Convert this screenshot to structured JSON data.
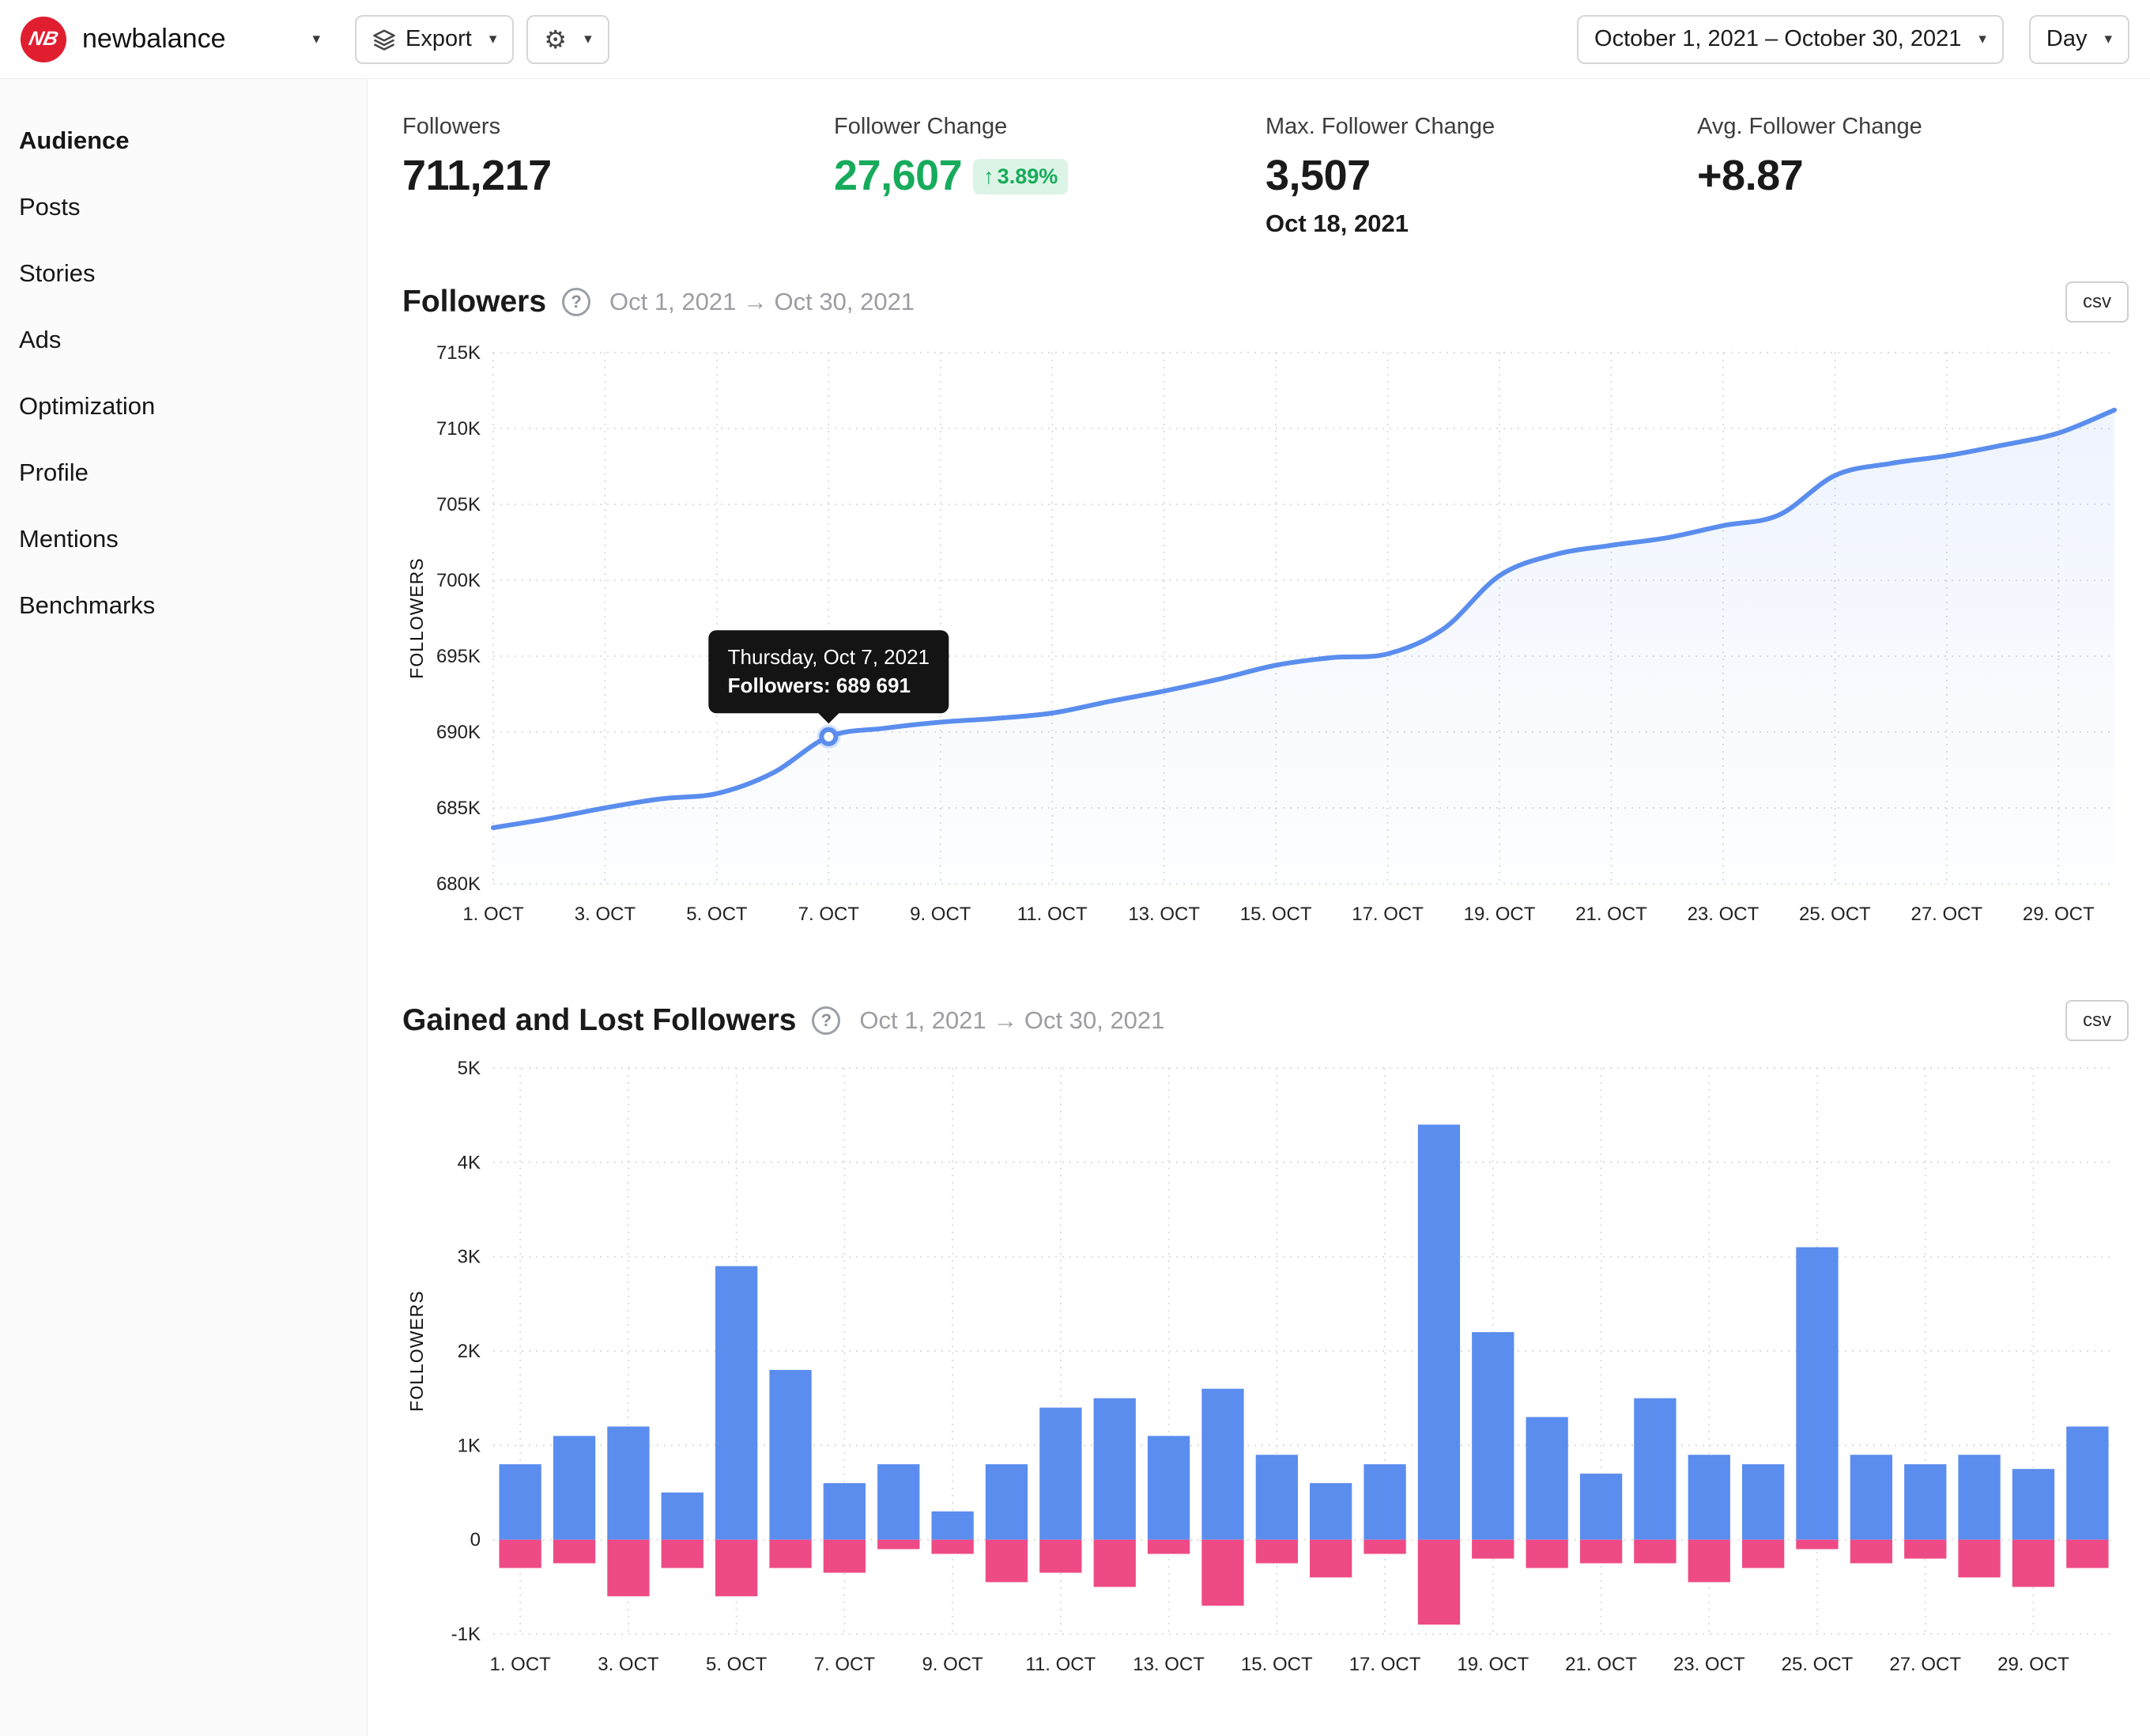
{
  "header": {
    "account_name": "newbalance",
    "export_label": "Export",
    "date_range": "October 1, 2021 – October 30, 2021",
    "granularity": "Day"
  },
  "icons": {
    "caret": "▾",
    "up_arrow": "↑",
    "gear": "⚙",
    "help": "?"
  },
  "colors": {
    "brand_red": "#e01e2f",
    "accent_green": "#17ab5c",
    "line_blue": "#5a8dee",
    "bar_blue": "#5b8def",
    "bar_pink": "#ee4a86"
  },
  "sidebar": {
    "items": [
      {
        "label": "Audience",
        "active": true
      },
      {
        "label": "Posts",
        "active": false
      },
      {
        "label": "Stories",
        "active": false
      },
      {
        "label": "Ads",
        "active": false
      },
      {
        "label": "Optimization",
        "active": false
      },
      {
        "label": "Profile",
        "active": false
      },
      {
        "label": "Mentions",
        "active": false
      },
      {
        "label": "Benchmarks",
        "active": false
      }
    ]
  },
  "stats": [
    {
      "label": "Followers",
      "value": "711,217"
    },
    {
      "label": "Follower Change",
      "value": "27,607",
      "badge": "3.89%"
    },
    {
      "label": "Max. Follower Change",
      "value": "3,507",
      "date": "Oct 18, 2021"
    },
    {
      "label": "Avg. Follower Change",
      "value": "+8.87"
    }
  ],
  "sections": {
    "followers": {
      "title": "Followers",
      "date_range": "Oct 1, 2021 → Oct 30, 2021",
      "csv": "csv"
    },
    "gained_lost": {
      "title": "Gained and Lost Followers",
      "date_range": "Oct 1, 2021 → Oct 30, 2021",
      "csv": "csv"
    }
  },
  "tooltip": {
    "title": "Thursday, Oct 7, 2021",
    "value": "Followers: 689 691"
  },
  "chart_data": [
    {
      "type": "line",
      "title": "Followers",
      "ylabel": "FOLLOWERS",
      "x_days": [
        1,
        2,
        3,
        4,
        5,
        6,
        7,
        8,
        9,
        10,
        11,
        12,
        13,
        14,
        15,
        16,
        17,
        18,
        19,
        20,
        21,
        22,
        23,
        24,
        25,
        26,
        27,
        28,
        29,
        30
      ],
      "x_tick_labels": [
        "1. OCT",
        "3. OCT",
        "5. OCT",
        "7. OCT",
        "9. OCT",
        "11. OCT",
        "13. OCT",
        "15. OCT",
        "17. OCT",
        "19. OCT",
        "21. OCT",
        "23. OCT",
        "25. OCT",
        "27. OCT",
        "29. OCT"
      ],
      "y_ticks": [
        {
          "value": 715000,
          "label": "715K"
        },
        {
          "value": 710000,
          "label": "710K"
        },
        {
          "value": 705000,
          "label": "705K"
        },
        {
          "value": 700000,
          "label": "700K"
        },
        {
          "value": 695000,
          "label": "695K"
        },
        {
          "value": 690000,
          "label": "690K"
        },
        {
          "value": 685000,
          "label": "685K"
        },
        {
          "value": 680000,
          "label": "680K"
        }
      ],
      "ylim": [
        680000,
        715000
      ],
      "line_color": "#5a8dee",
      "grid": true,
      "legend": "none",
      "values": [
        683700,
        684300,
        685000,
        685600,
        685950,
        687300,
        689691,
        690250,
        690650,
        690900,
        691250,
        692000,
        692700,
        693500,
        694400,
        694900,
        695150,
        696800,
        700300,
        701700,
        702300,
        702800,
        703600,
        704300,
        706900,
        707700,
        708200,
        708900,
        709700,
        711217
      ],
      "highlight": {
        "index": 6,
        "day": 7,
        "value": 689691,
        "tooltip_title": "Thursday, Oct 7, 2021",
        "tooltip_text": "Followers: 689 691"
      }
    },
    {
      "type": "bar",
      "title": "Gained and Lost Followers",
      "ylabel": "FOLLOWERS",
      "x_days": [
        1,
        2,
        3,
        4,
        5,
        6,
        7,
        8,
        9,
        10,
        11,
        12,
        13,
        14,
        15,
        16,
        17,
        18,
        19,
        20,
        21,
        22,
        23,
        24,
        25,
        26,
        27,
        28,
        29,
        30
      ],
      "x_tick_labels": [
        "1. OCT",
        "3. OCT",
        "5. OCT",
        "7. OCT",
        "9. OCT",
        "11. OCT",
        "13. OCT",
        "15. OCT",
        "17. OCT",
        "19. OCT",
        "21. OCT",
        "23. OCT",
        "25. OCT",
        "27. OCT",
        "29. OCT"
      ],
      "y_ticks": [
        {
          "value": 5000,
          "label": "5K"
        },
        {
          "value": 4000,
          "label": "4K"
        },
        {
          "value": 3000,
          "label": "3K"
        },
        {
          "value": 2000,
          "label": "2K"
        },
        {
          "value": 1000,
          "label": "1K"
        },
        {
          "value": 0,
          "label": "0"
        },
        {
          "value": -1000,
          "label": "-1K"
        }
      ],
      "ylim": [
        -1000,
        5000
      ],
      "grid": true,
      "legend": "none",
      "series": [
        {
          "name": "Gained Followers",
          "color": "#5b8def",
          "values": [
            800,
            1100,
            1200,
            500,
            2900,
            1800,
            600,
            800,
            300,
            800,
            1400,
            1500,
            1100,
            1600,
            900,
            600,
            800,
            4400,
            2200,
            1300,
            700,
            1500,
            900,
            800,
            3100,
            900,
            800,
            900,
            750,
            1200
          ]
        },
        {
          "name": "Lost Followers",
          "color": "#ee4a86",
          "values": [
            -300,
            -250,
            -600,
            -300,
            -600,
            -300,
            -350,
            -100,
            -150,
            -450,
            -350,
            -500,
            -150,
            -700,
            -250,
            -400,
            -150,
            -900,
            -200,
            -300,
            -250,
            -250,
            -450,
            -300,
            -100,
            -250,
            -200,
            -400,
            -500,
            -300
          ]
        }
      ]
    }
  ]
}
